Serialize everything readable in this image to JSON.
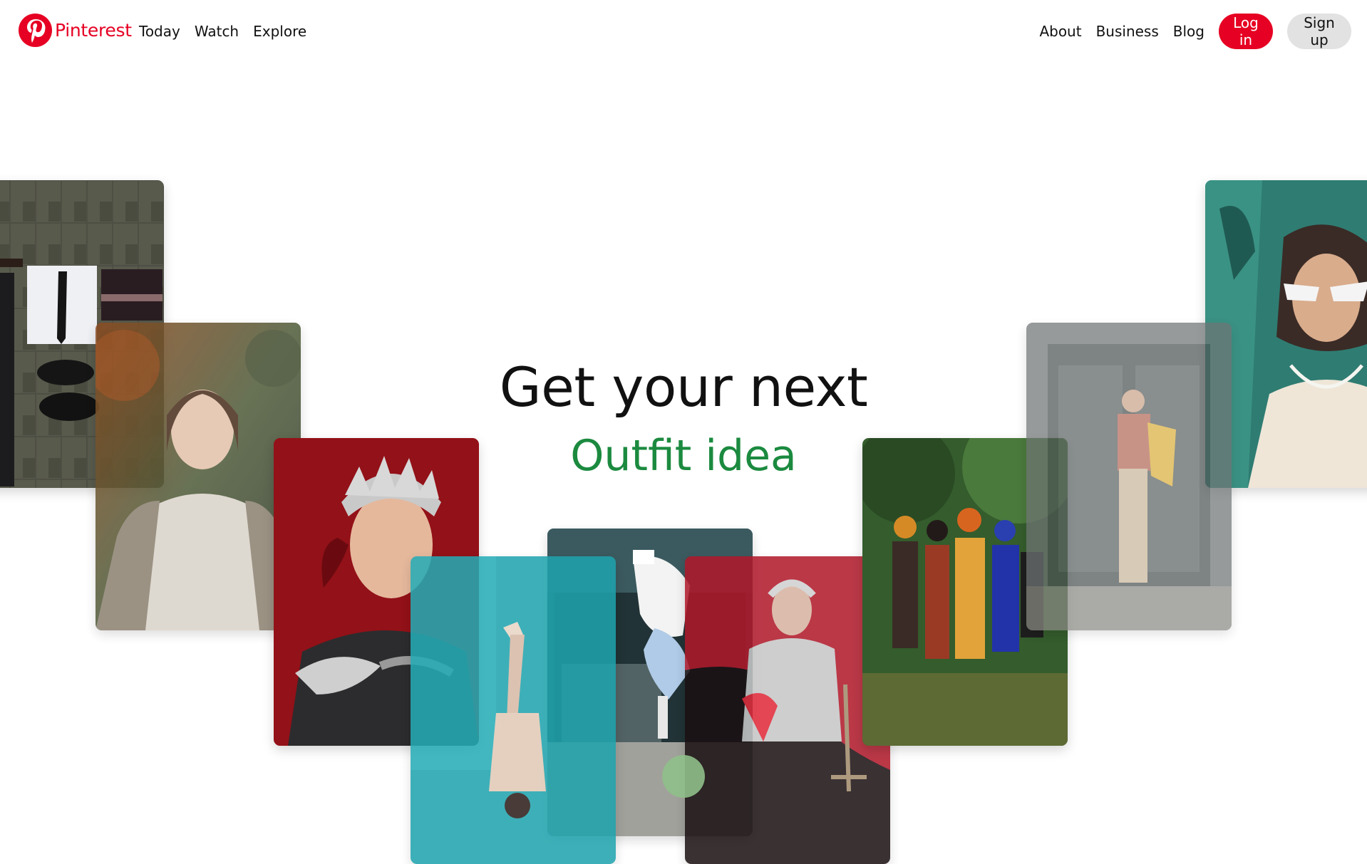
{
  "header": {
    "logo_text": "Pinterest",
    "logo_icon": "pinterest-logo-icon",
    "brand_color": "#e60023",
    "nav_left": [
      "Today",
      "Watch",
      "Explore"
    ],
    "nav_right": [
      "About",
      "Business",
      "Blog"
    ],
    "login_label": "Log in",
    "signup_label": "Sign up"
  },
  "hero": {
    "title": "Get your next",
    "subtitle": "Outfit idea",
    "subtitle_color": "#1b8a3f"
  },
  "pins": [
    {
      "name": "pin-flatlay-shirt-tie",
      "description_icon": "flatlay-outfit-image"
    },
    {
      "name": "pin-woman-sweater-autumn",
      "description_icon": "portrait-image"
    },
    {
      "name": "pin-woman-crown-red",
      "description_icon": "portrait-image"
    },
    {
      "name": "pin-breakdancer",
      "description_icon": "action-image"
    },
    {
      "name": "pin-upside-down-teal",
      "description_icon": "action-image"
    },
    {
      "name": "pin-warrior-red",
      "description_icon": "portrait-image"
    },
    {
      "name": "pin-group-street-style",
      "description_icon": "group-image"
    },
    {
      "name": "pin-man-doorway",
      "description_icon": "portrait-image"
    },
    {
      "name": "pin-woman-sunglasses-scarf",
      "description_icon": "portrait-image"
    }
  ]
}
